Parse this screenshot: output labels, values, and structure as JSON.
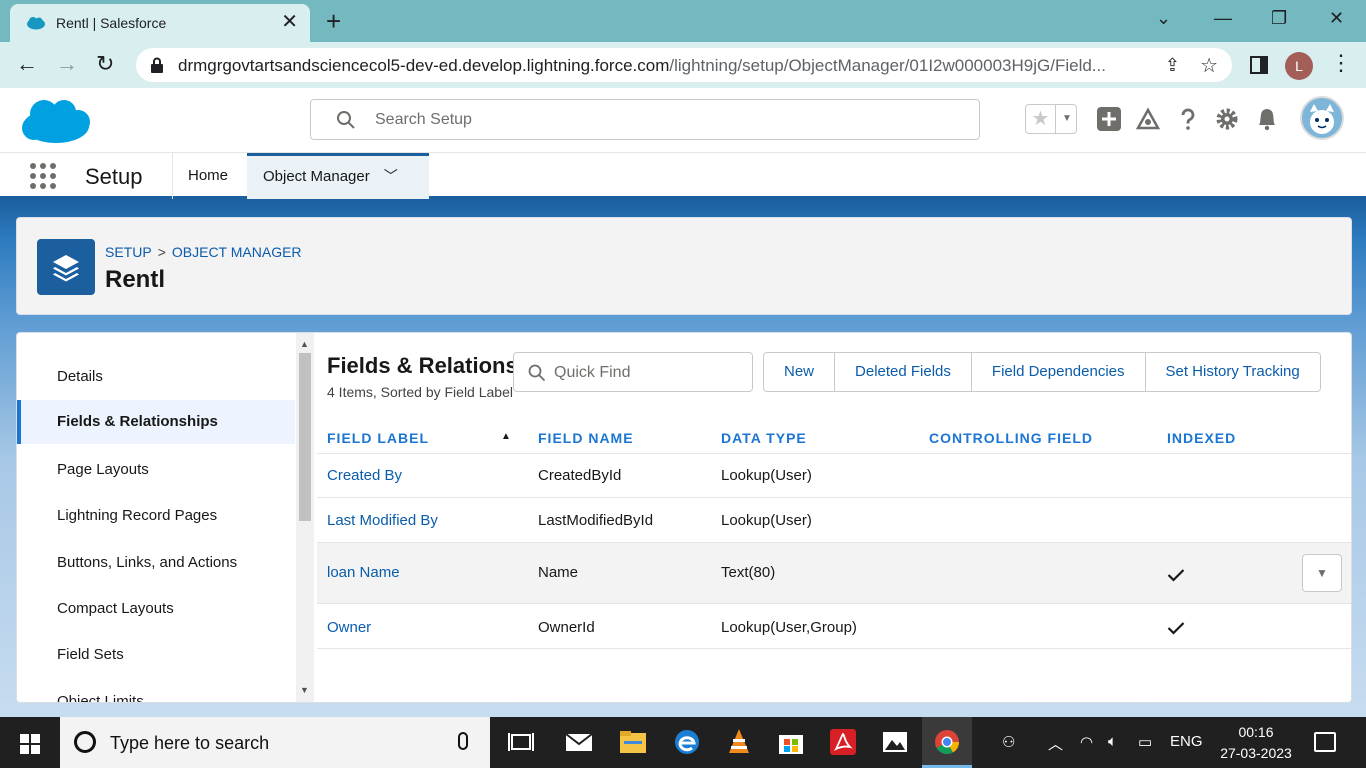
{
  "browser": {
    "tab_title": "Rentl | Salesforce",
    "url_host": "drmgrgovtartsandsciencecol5-dev-ed.develop.lightning.force.com",
    "url_path": "/lightning/setup/ObjectManager/01I2w000003H9jG/Field...",
    "profile_initial": "L",
    "window_controls": [
      "⌄",
      "—",
      "❐",
      "✕"
    ]
  },
  "sf": {
    "search_placeholder": "Search Setup",
    "app_name": "Setup",
    "nav": {
      "home": "Home",
      "object_manager": "Object Manager"
    }
  },
  "object": {
    "breadcrumb": [
      "SETUP",
      "OBJECT MANAGER"
    ],
    "breadcrumb_sep": ">",
    "name": "Rentl"
  },
  "sidebar": {
    "items": [
      {
        "label": "Details"
      },
      {
        "label": "Fields & Relationships",
        "active": true
      },
      {
        "label": "Page Layouts"
      },
      {
        "label": "Lightning Record Pages"
      },
      {
        "label": "Buttons, Links, and Actions"
      },
      {
        "label": "Compact Layouts"
      },
      {
        "label": "Field Sets"
      },
      {
        "label": "Object Limits"
      }
    ]
  },
  "fields": {
    "title": "Fields & Relationships",
    "subtitle": "4 Items, Sorted by Field Label",
    "quick_find_placeholder": "Quick Find",
    "buttons": [
      "New",
      "Deleted Fields",
      "Field Dependencies",
      "Set History Tracking"
    ],
    "columns": [
      "FIELD LABEL",
      "FIELD NAME",
      "DATA TYPE",
      "CONTROLLING FIELD",
      "INDEXED"
    ],
    "rows": [
      {
        "label": "Created By",
        "name": "CreatedById",
        "type": "Lookup(User)",
        "controlling": "",
        "indexed": false
      },
      {
        "label": "Last Modified By",
        "name": "LastModifiedById",
        "type": "Lookup(User)",
        "controlling": "",
        "indexed": false
      },
      {
        "label": "loan Name",
        "name": "Name",
        "type": "Text(80)",
        "controlling": "",
        "indexed": true
      },
      {
        "label": "Owner",
        "name": "OwnerId",
        "type": "Lookup(User,Group)",
        "controlling": "",
        "indexed": true
      }
    ]
  },
  "taskbar": {
    "search_placeholder": "Type here to search",
    "language": "ENG",
    "time": "00:16",
    "date": "27-03-2023"
  },
  "colors": {
    "sf_blue": "#1b5f9e",
    "link": "#0b5cab",
    "chrome_tab_strip": "#74b9bf"
  }
}
